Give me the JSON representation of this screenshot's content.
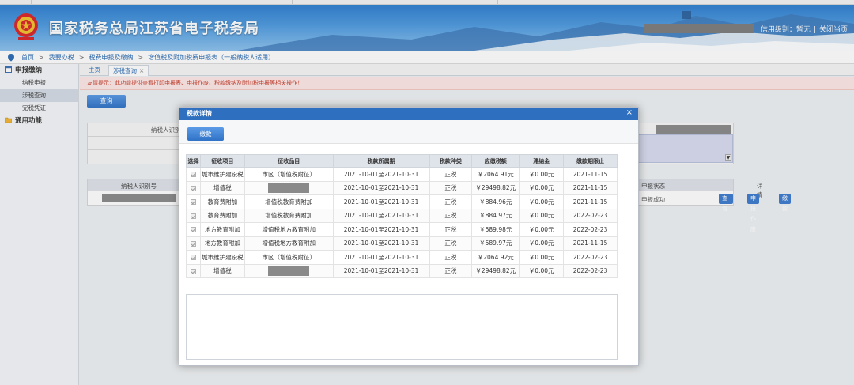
{
  "header": {
    "site_title": "国家税务总局江苏省电子税务局",
    "credit_label": "信用级别：暂无",
    "close_label": "关闭当页",
    "separator": "|",
    "colors": {
      "banner_top": "#2f7fd0",
      "banner_bottom": "#8cc2ee"
    }
  },
  "breadcrumb": {
    "items": [
      "首页",
      "我要办税",
      "税费申报及缴纳",
      "增值税及附加税费申报表（一般纳税人适用）"
    ],
    "separator": ">"
  },
  "sidebar": {
    "groups": [
      {
        "label": "申报缴纳",
        "icon": "calendar-icon",
        "items": [
          "纳税申报",
          "涉税查询",
          "完税凭证"
        ]
      },
      {
        "label": "通用功能",
        "icon": "folder-icon",
        "items": []
      }
    ],
    "active_item": "涉税查询"
  },
  "tabs": [
    {
      "label": "主页"
    },
    {
      "label": "涉税查询",
      "close": "×"
    }
  ],
  "notice": "友情提示：此功能提供查看打印申报表、申报作废、税款缴纳及附加税申报等相关操作！",
  "query_button": "查询",
  "form": {
    "taxpayer_label": "纳税人识别"
  },
  "result_table": {
    "headers": [
      "纳税人识别号",
      "申报状态",
      "详情"
    ],
    "status": "申报成功",
    "buttons": [
      "查看",
      "申报作废",
      "缴款"
    ]
  },
  "modal": {
    "title": "税款详情",
    "close": "×",
    "pay_button": "缴款",
    "columns": [
      "选择",
      "征收项目",
      "征收品目",
      "税款所属期",
      "税款种类",
      "应缴税额",
      "滞纳金",
      "缴款期限止"
    ],
    "rows": [
      {
        "item": "城市维护建设税",
        "subitem": "市区（增值税附征）",
        "period": "2021-10-01至2021-10-31",
        "kind": "正税",
        "amount": "￥2064.91元",
        "late_fee": "￥0.00元",
        "deadline": "2021-11-15",
        "masked": false
      },
      {
        "item": "增值税",
        "subitem": "",
        "period": "2021-10-01至2021-10-31",
        "kind": "正税",
        "amount": "￥29498.82元",
        "late_fee": "￥0.00元",
        "deadline": "2021-11-15",
        "masked": true
      },
      {
        "item": "教育费附加",
        "subitem": "增值税教育费附加",
        "period": "2021-10-01至2021-10-31",
        "kind": "正税",
        "amount": "￥884.96元",
        "late_fee": "￥0.00元",
        "deadline": "2021-11-15",
        "masked": false
      },
      {
        "item": "教育费附加",
        "subitem": "增值税教育费附加",
        "period": "2021-10-01至2021-10-31",
        "kind": "正税",
        "amount": "￥884.97元",
        "late_fee": "￥0.00元",
        "deadline": "2022-02-23",
        "masked": false
      },
      {
        "item": "地方教育附加",
        "subitem": "增值税地方教育附加",
        "period": "2021-10-01至2021-10-31",
        "kind": "正税",
        "amount": "￥589.98元",
        "late_fee": "￥0.00元",
        "deadline": "2022-02-23",
        "masked": false
      },
      {
        "item": "地方教育附加",
        "subitem": "增值税地方教育附加",
        "period": "2021-10-01至2021-10-31",
        "kind": "正税",
        "amount": "￥589.97元",
        "late_fee": "￥0.00元",
        "deadline": "2021-11-15",
        "masked": false
      },
      {
        "item": "城市维护建设税",
        "subitem": "市区（增值税附征）",
        "period": "2021-10-01至2021-10-31",
        "kind": "正税",
        "amount": "￥2064.92元",
        "late_fee": "￥0.00元",
        "deadline": "2022-02-23",
        "masked": false
      },
      {
        "item": "增值税",
        "subitem": "",
        "period": "2021-10-01至2021-10-31",
        "kind": "正税",
        "amount": "￥29498.82元",
        "late_fee": "￥0.00元",
        "deadline": "2022-02-23",
        "masked": true
      }
    ]
  }
}
